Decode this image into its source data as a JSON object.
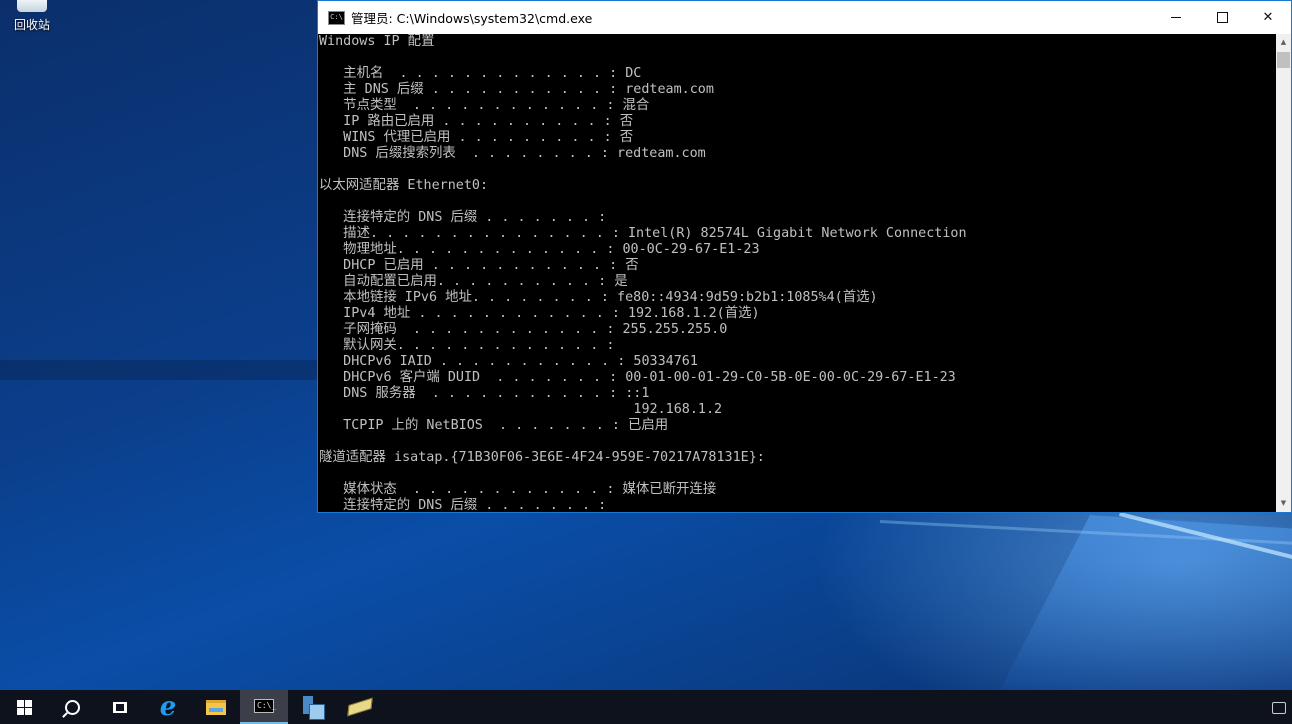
{
  "desktop": {
    "icons": [
      {
        "label": "回收站",
        "icon": "recycle-bin-icon"
      }
    ]
  },
  "window": {
    "title": "管理员: C:\\Windows\\system32\\cmd.exe",
    "icon": "cmd-icon",
    "controls": {
      "minimize": "—",
      "maximize": "☐",
      "close": "✕"
    }
  },
  "console": {
    "lines": [
      "Windows IP 配置",
      "",
      "   主机名  . . . . . . . . . . . . . : DC",
      "   主 DNS 后缀 . . . . . . . . . . . : redteam.com",
      "   节点类型  . . . . . . . . . . . . : 混合",
      "   IP 路由已启用 . . . . . . . . . . : 否",
      "   WINS 代理已启用 . . . . . . . . . : 否",
      "   DNS 后缀搜索列表  . . . . . . . . : redteam.com",
      "",
      "以太网适配器 Ethernet0:",
      "",
      "   连接特定的 DNS 后缀 . . . . . . . :",
      "   描述. . . . . . . . . . . . . . . : Intel(R) 82574L Gigabit Network Connection",
      "   物理地址. . . . . . . . . . . . . : 00-0C-29-67-E1-23",
      "   DHCP 已启用 . . . . . . . . . . . : 否",
      "   自动配置已启用. . . . . . . . . . : 是",
      "   本地链接 IPv6 地址. . . . . . . . : fe80::4934:9d59:b2b1:1085%4(首选)",
      "   IPv4 地址 . . . . . . . . . . . . : 192.168.1.2(首选)",
      "   子网掩码  . . . . . . . . . . . . : 255.255.255.0",
      "   默认网关. . . . . . . . . . . . . :",
      "   DHCPv6 IAID . . . . . . . . . . . : 50334761",
      "   DHCPv6 客户端 DUID  . . . . . . . : 00-01-00-01-29-C0-5B-0E-00-0C-29-67-E1-23",
      "   DNS 服务器  . . . . . . . . . . . : ::1",
      "                                       192.168.1.2",
      "   TCPIP 上的 NetBIOS  . . . . . . . : 已启用",
      "",
      "隧道适配器 isatap.{71B30F06-3E6E-4F24-959E-70217A78131E}:",
      "",
      "   媒体状态  . . . . . . . . . . . . : 媒体已断开连接",
      "   连接特定的 DNS 后缀 . . . . . . . :"
    ]
  },
  "taskbar": {
    "items": [
      {
        "name": "start-button",
        "icon": "windows-logo-icon"
      },
      {
        "name": "search-button",
        "icon": "search-icon"
      },
      {
        "name": "task-view-button",
        "icon": "task-view-icon"
      },
      {
        "name": "internet-explorer-button",
        "icon": "internet-explorer-icon",
        "glyph": "e"
      },
      {
        "name": "file-explorer-button",
        "icon": "folder-icon"
      },
      {
        "name": "cmd-taskbar-button",
        "icon": "cmd-icon",
        "active": true
      },
      {
        "name": "server-manager-button",
        "icon": "server-manager-icon"
      },
      {
        "name": "powershell-button",
        "icon": "powershell-icon"
      }
    ]
  },
  "colors": {
    "console_text": "#c0c0c0",
    "console_bg": "#000000",
    "taskbar_bg": "#0d121c",
    "window_border": "#1a78d0"
  }
}
